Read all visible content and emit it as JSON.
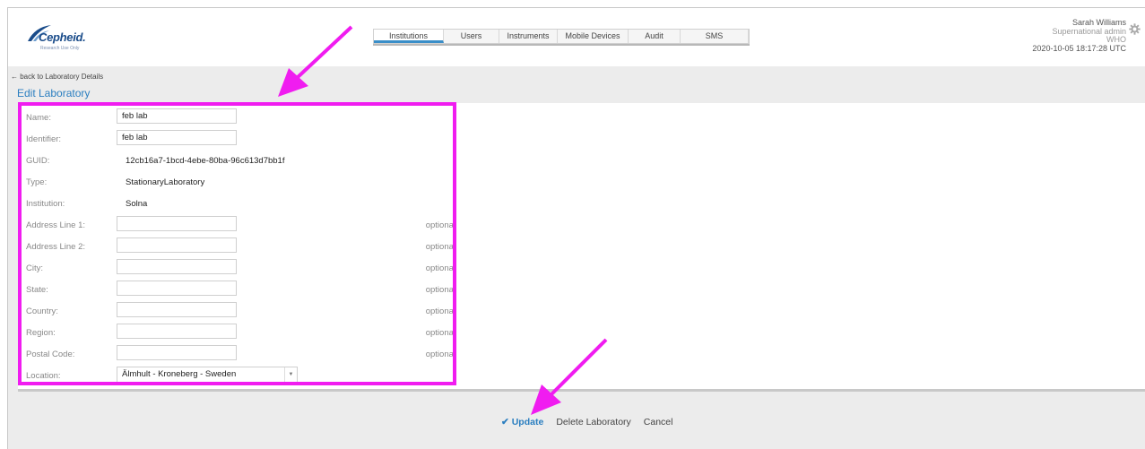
{
  "brand": {
    "name": "Cepheid.",
    "tagline": "Research Use Only"
  },
  "nav": {
    "tabs": [
      {
        "label": "Institutions",
        "active": true,
        "width": 78
      },
      {
        "label": "Users",
        "active": false,
        "width": 62
      },
      {
        "label": "Instruments",
        "active": false,
        "width": 65
      },
      {
        "label": "Mobile Devices",
        "active": false,
        "width": 79
      },
      {
        "label": "Audit",
        "active": false,
        "width": 58
      },
      {
        "label": "SMS",
        "active": false,
        "width": 76
      }
    ]
  },
  "user": {
    "name": "Sarah Williams",
    "role": "Supernational admin",
    "org": "WHO",
    "timestamp": "2020-10-05 18:17:28 UTC"
  },
  "back_link": "← back to Laboratory Details",
  "page_title": "Edit Laboratory",
  "form": {
    "name": {
      "label": "Name:",
      "value": "feb lab"
    },
    "identifier": {
      "label": "Identifier:",
      "value": "feb lab"
    },
    "guid": {
      "label": "GUID:",
      "value": "12cb16a7-1bcd-4ebe-80ba-96c613d7bb1f"
    },
    "type": {
      "label": "Type:",
      "value": "StationaryLaboratory"
    },
    "institution": {
      "label": "Institution:",
      "value": "Solna"
    },
    "address1": {
      "label": "Address Line 1:",
      "value": "",
      "hint": "optional"
    },
    "address2": {
      "label": "Address Line 2:",
      "value": "",
      "hint": "optional"
    },
    "city": {
      "label": "City:",
      "value": "",
      "hint": "optional"
    },
    "state": {
      "label": "State:",
      "value": "",
      "hint": "optional"
    },
    "country": {
      "label": "Country:",
      "value": "",
      "hint": "optional"
    },
    "region": {
      "label": "Region:",
      "value": "",
      "hint": "optional"
    },
    "postal": {
      "label": "Postal Code:",
      "value": "",
      "hint": "optional"
    },
    "location": {
      "label": "Location:",
      "value": "Älmhult - Kroneberg - Sweden"
    }
  },
  "actions": {
    "update": "✔ Update",
    "delete": "Delete Laboratory",
    "cancel": "Cancel"
  },
  "colors": {
    "accent": "#2a7ec0",
    "annotation": "#f01cf0"
  }
}
